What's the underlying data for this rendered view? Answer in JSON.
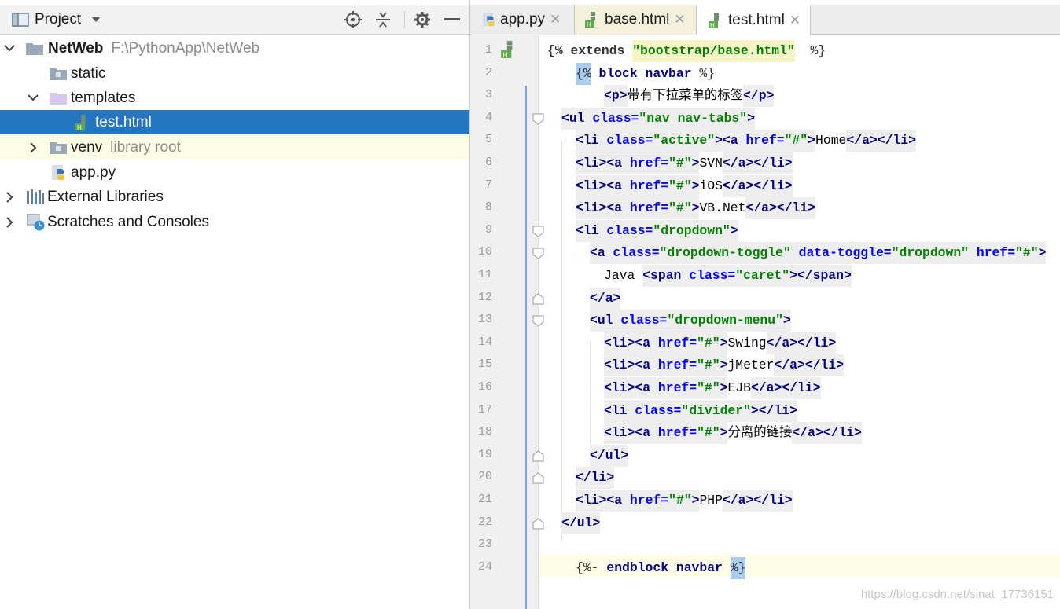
{
  "project": {
    "title": "Project",
    "tree": [
      {
        "label": "NetWeb",
        "extra": "F:\\PythonApp\\NetWeb"
      },
      {
        "label": "static"
      },
      {
        "label": "templates"
      },
      {
        "label": "test.html"
      },
      {
        "label": "venv",
        "extra": "library root"
      },
      {
        "label": "app.py"
      },
      {
        "label": "External Libraries"
      },
      {
        "label": "Scratches and Consoles"
      }
    ]
  },
  "editor": {
    "tabs": [
      {
        "label": "app.py"
      },
      {
        "label": "base.html"
      },
      {
        "label": "test.html"
      }
    ],
    "line_numbers": [
      "1",
      "2",
      "3",
      "4",
      "5",
      "6",
      "7",
      "8",
      "9",
      "10",
      "11",
      "12",
      "13",
      "14",
      "15",
      "16",
      "17",
      "18",
      "19",
      "20",
      "21",
      "22",
      "23",
      "24"
    ],
    "code": {
      "l1": [
        "{% extends ",
        "\"bootstrap/base.html\"",
        "  %}"
      ],
      "l2": [
        "{%",
        " block navbar ",
        "%}"
      ],
      "l3": [
        "<",
        "p",
        ">",
        "带有下拉菜单的标签",
        "</",
        "p",
        ">"
      ],
      "l4": [
        "<",
        "ul",
        " class=",
        "\"nav nav-tabs\"",
        ">"
      ],
      "l5": [
        "<",
        "li",
        " class=",
        "\"active\"",
        "><",
        "a",
        " href=",
        "\"#\"",
        ">",
        "Home",
        "</",
        "a",
        "></",
        "li",
        ">"
      ],
      "l6": [
        "<",
        "li",
        "><",
        "a",
        " href=",
        "\"#\"",
        ">",
        "SVN",
        "</",
        "a",
        "></",
        "li",
        ">"
      ],
      "l7": [
        "<",
        "li",
        "><",
        "a",
        " href=",
        "\"#\"",
        ">",
        "iOS",
        "</",
        "a",
        "></",
        "li",
        ">"
      ],
      "l8": [
        "<",
        "li",
        "><",
        "a",
        " href=",
        "\"#\"",
        ">",
        "VB.Net",
        "</",
        "a",
        "></",
        "li",
        ">"
      ],
      "l9": [
        "<",
        "li",
        " class=",
        "\"dropdown\"",
        ">"
      ],
      "l10": [
        "<",
        "a",
        " class=",
        "\"dropdown-toggle\"",
        " data-toggle=",
        "\"dropdown\"",
        " href=",
        "\"#\"",
        ">"
      ],
      "l11": [
        "Java ",
        "<",
        "span",
        " class=",
        "\"caret\"",
        "></",
        "span",
        ">"
      ],
      "l12": [
        "</",
        "a",
        ">"
      ],
      "l13": [
        "<",
        "ul",
        " class=",
        "\"dropdown-menu\"",
        ">"
      ],
      "l14": [
        "<",
        "li",
        "><",
        "a",
        " href=",
        "\"#\"",
        ">",
        "Swing",
        "</",
        "a",
        "></",
        "li",
        ">"
      ],
      "l15": [
        "<",
        "li",
        "><",
        "a",
        " href=",
        "\"#\"",
        ">",
        "jMeter",
        "</",
        "a",
        "></",
        "li",
        ">"
      ],
      "l16": [
        "<",
        "li",
        "><",
        "a",
        " href=",
        "\"#\"",
        ">",
        "EJB",
        "</",
        "a",
        "></",
        "li",
        ">"
      ],
      "l17": [
        "<",
        "li",
        " class=",
        "\"divider\"",
        "></",
        "li",
        ">"
      ],
      "l18": [
        "<",
        "li",
        "><",
        "a",
        " href=",
        "\"#\"",
        ">",
        "分离的链接",
        "</",
        "a",
        "></",
        "li",
        ">"
      ],
      "l19": [
        "</",
        "ul",
        ">"
      ],
      "l20": [
        "</",
        "li",
        ">"
      ],
      "l21": [
        "<",
        "li",
        "><",
        "a",
        " href=",
        "\"#\"",
        ">",
        "PHP",
        "</",
        "a",
        "></",
        "li",
        ">"
      ],
      "l22": [
        "</",
        "ul",
        ">"
      ],
      "l24": [
        "{%-",
        " endblock navbar ",
        "%}"
      ]
    }
  },
  "watermark": "https://blog.csdn.net/sinat_17736151",
  "colors": {
    "selection": "#2675bf",
    "tag": "#000080",
    "attr": "#0000ff",
    "value": "#008000",
    "caret_line": "#fdfce5"
  }
}
